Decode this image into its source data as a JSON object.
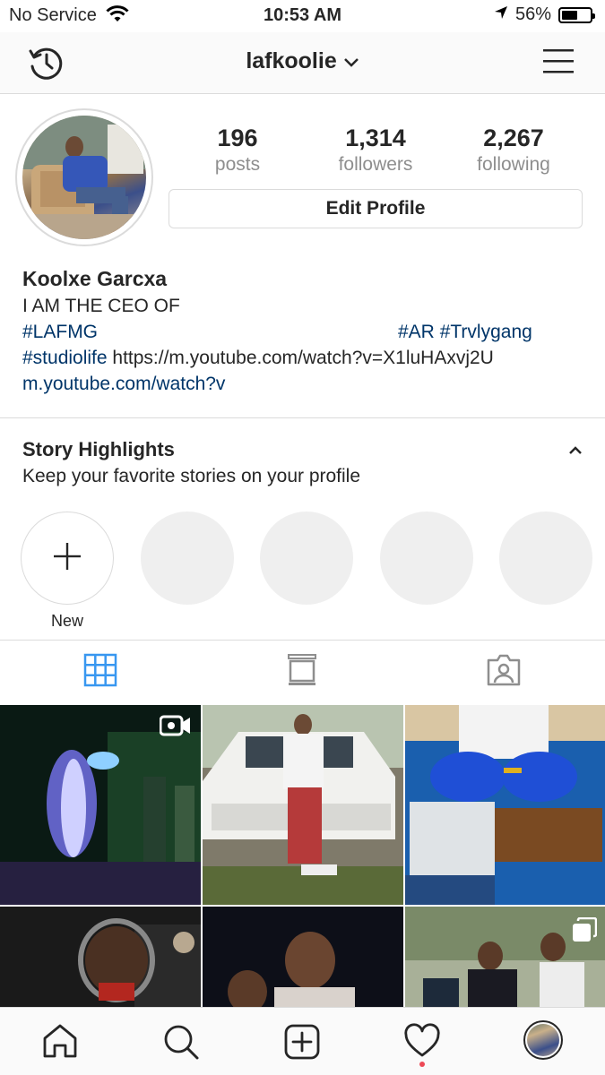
{
  "status_bar": {
    "carrier": "No Service",
    "time": "10:53 AM",
    "battery": "56%",
    "battery_level": 0.56
  },
  "header": {
    "username": "lafkoolie"
  },
  "profile": {
    "stats": [
      {
        "value": "196",
        "label": "posts"
      },
      {
        "value": "1,314",
        "label": "followers"
      },
      {
        "value": "2,267",
        "label": "following"
      }
    ],
    "edit_label": "Edit Profile",
    "name": "Koolxe Garcxa",
    "bio_line1": "I AM THE CEO OF",
    "tag_lafmg": "#LAFMG",
    "tag_ar": "#AR",
    "tag_trvlygang": "#Trvlygang",
    "tag_studiolife": "#studiolife",
    "url_text": "https://m.youtube.com/watch?v=X1luHAxvj2U",
    "link_display": "m.youtube.com/watch?v"
  },
  "highlights": {
    "title": "Story Highlights",
    "subtitle": "Keep your favorite stories on your profile",
    "new_label": "New"
  },
  "colors": {
    "link": "#003569",
    "border": "#dbdbdb",
    "muted": "#8e8e8e",
    "active_tab": "#3897f0",
    "notification": "#ed4956"
  }
}
